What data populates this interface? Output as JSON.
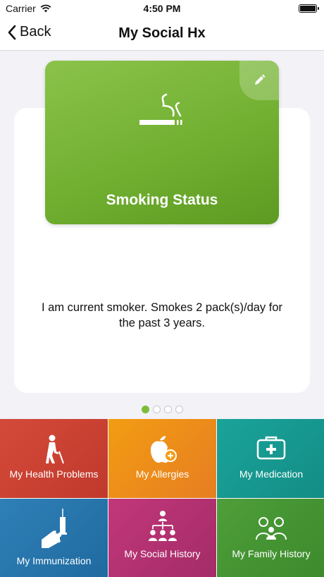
{
  "status_bar": {
    "carrier": "Carrier",
    "time": "4:50 PM"
  },
  "nav": {
    "back_label": "Back",
    "title": "My Social Hx"
  },
  "card": {
    "title": "Smoking Status",
    "description": "I am current smoker. Smokes 2 pack(s)/day for the past 3 years."
  },
  "pager": {
    "count": 4,
    "active": 0
  },
  "menu": [
    {
      "label": "My Health Problems",
      "icon": "elderly-person-icon"
    },
    {
      "label": "My Allergies",
      "icon": "apple-plus-icon"
    },
    {
      "label": "My Medication",
      "icon": "medical-kit-icon"
    },
    {
      "label": "My Immunization",
      "icon": "syringe-hand-icon"
    },
    {
      "label": "My Social History",
      "icon": "people-network-icon"
    },
    {
      "label": "My Family History",
      "icon": "family-icon"
    }
  ],
  "colors": {
    "card_green": "#7cbd3a",
    "active_dot": "#7cbd3a"
  }
}
